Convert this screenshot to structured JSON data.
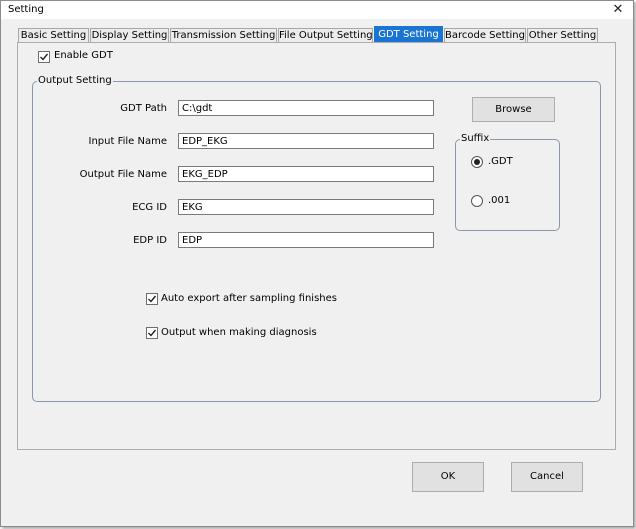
{
  "window": {
    "title": "Setting",
    "close_glyph": "✕"
  },
  "tabs": [
    {
      "label": "Basic Setting",
      "active": false
    },
    {
      "label": "Display Setting",
      "active": false
    },
    {
      "label": "Transmission Setting",
      "active": false
    },
    {
      "label": "File Output Setting",
      "active": false
    },
    {
      "label": "GDT Setting",
      "active": true
    },
    {
      "label": "Barcode Setting",
      "active": false
    },
    {
      "label": "Other Setting",
      "active": false
    }
  ],
  "enable_gdt": {
    "label": "Enable GDT",
    "checked": true
  },
  "output_setting": {
    "legend": "Output Setting",
    "fields": {
      "gdt_path": {
        "label": "GDT Path",
        "value": "C:\\gdt"
      },
      "input_file_name": {
        "label": "Input File Name",
        "value": "EDP_EKG"
      },
      "output_file_name": {
        "label": "Output File Name",
        "value": "EKG_EDP"
      },
      "ecg_id": {
        "label": "ECG ID",
        "value": "EKG"
      },
      "edp_id": {
        "label": "EDP ID",
        "value": "EDP"
      }
    },
    "browse_label": "Browse",
    "suffix": {
      "legend": "Suffix",
      "options": [
        {
          "label": ".GDT",
          "selected": true
        },
        {
          "label": ".001",
          "selected": false
        }
      ]
    },
    "auto_export": {
      "label": "Auto export after sampling finishes",
      "checked": true
    },
    "output_diagnosis": {
      "label": "Output when making diagnosis",
      "checked": true
    }
  },
  "buttons": {
    "ok": "OK",
    "cancel": "Cancel"
  },
  "icons": {
    "check": "checkmark-icon",
    "close": "close-icon"
  }
}
